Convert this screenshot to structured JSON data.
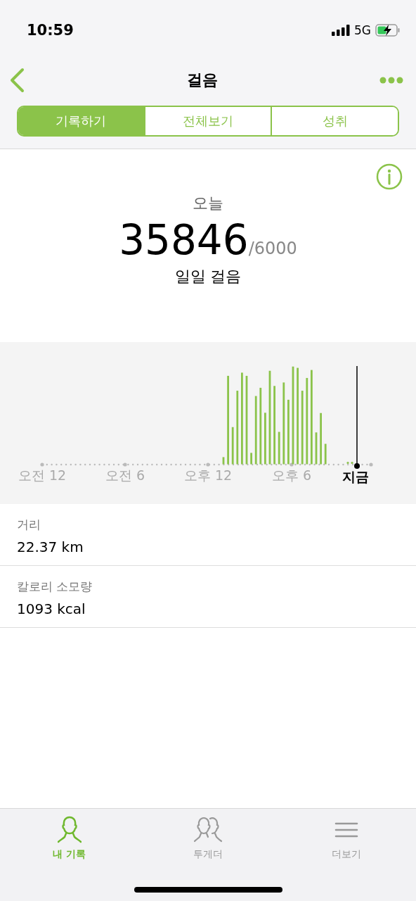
{
  "status_bar": {
    "time": "10:59",
    "network": "5G"
  },
  "header": {
    "title": "걸음"
  },
  "segments": [
    {
      "label": "기록하기",
      "selected": true
    },
    {
      "label": "전체보기",
      "selected": false
    },
    {
      "label": "성취",
      "selected": false
    }
  ],
  "summary": {
    "period": "오늘",
    "steps": "35846",
    "goal": "/6000",
    "caption": "일일 걸음"
  },
  "chart": {
    "axis_labels": [
      {
        "label": "오전 12",
        "kind": "time"
      },
      {
        "label": "오전 6",
        "kind": "time"
      },
      {
        "label": "오후 12",
        "kind": "time"
      },
      {
        "label": "오후 6",
        "kind": "time"
      },
      {
        "label": "지금",
        "kind": "now"
      }
    ]
  },
  "stats": [
    {
      "label": "거리",
      "value": "22.37 km"
    },
    {
      "label": "칼로리 소모량",
      "value": "1093 kcal"
    }
  ],
  "tab_bar": [
    {
      "label": "내 기록",
      "selected": true
    },
    {
      "label": "투게더",
      "selected": false
    },
    {
      "label": "더보기",
      "selected": false
    }
  ]
}
